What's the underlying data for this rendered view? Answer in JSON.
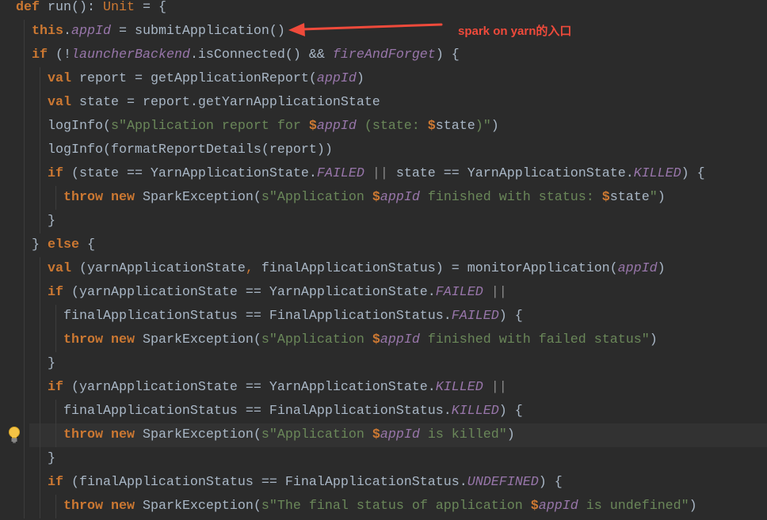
{
  "editor": {
    "language": "scala",
    "colors": {
      "background": "#2b2b2b",
      "caret_row": "#323232",
      "plain": "#a9b7c6",
      "keyword": "#cc7832",
      "field": "#9876aa",
      "string": "#6a8759",
      "operator": "#8a8a8a",
      "indent_guide": "#3c3c3c"
    },
    "lines": [
      {
        "indent": "",
        "tokens": [
          {
            "keyword": "def"
          },
          {
            "text": " run(): "
          },
          {
            "type": "Unit"
          },
          {
            "text": " = {"
          }
        ]
      },
      {
        "indent": "  ",
        "tokens": [
          {
            "keyword": "this"
          },
          {
            "text": "."
          },
          {
            "field": "appId"
          },
          {
            "text": " = submitApplication()"
          }
        ]
      },
      {
        "indent": "  ",
        "tokens": [
          {
            "keyword": "if"
          },
          {
            "text": " (!"
          },
          {
            "field": "launcherBackend"
          },
          {
            "text": ".isConnected() && "
          },
          {
            "field": "fireAndForget"
          },
          {
            "text": ") {"
          }
        ]
      },
      {
        "indent": "    ",
        "tokens": [
          {
            "keyword": "val"
          },
          {
            "text": " report = getApplicationReport("
          },
          {
            "field": "appId"
          },
          {
            "text": ")"
          }
        ]
      },
      {
        "indent": "    ",
        "tokens": [
          {
            "keyword": "val"
          },
          {
            "text": " state = report.getYarnApplicationState"
          }
        ]
      },
      {
        "indent": "    ",
        "tokens": [
          {
            "text": "logInfo("
          },
          {
            "string": "s\"Application report for "
          },
          {
            "interp": "$"
          },
          {
            "field": "appId"
          },
          {
            "string": " (state: "
          },
          {
            "interp": "$"
          },
          {
            "text": "state"
          },
          {
            "string": ")\""
          },
          {
            "text": ")"
          }
        ]
      },
      {
        "indent": "    ",
        "tokens": [
          {
            "text": "logInfo(formatReportDetails(report))"
          }
        ]
      },
      {
        "indent": "    ",
        "tokens": [
          {
            "keyword": "if"
          },
          {
            "text": " (state == YarnApplicationState."
          },
          {
            "field": "FAILED"
          },
          {
            "text": " "
          },
          {
            "op": "||"
          },
          {
            "text": " state == YarnApplicationState."
          },
          {
            "field": "KILLED"
          },
          {
            "text": ") {"
          }
        ]
      },
      {
        "indent": "      ",
        "tokens": [
          {
            "keyword": "throw"
          },
          {
            "text": " "
          },
          {
            "keyword": "new"
          },
          {
            "text": " SparkException("
          },
          {
            "string": "s\"Application "
          },
          {
            "interp": "$"
          },
          {
            "field": "appId"
          },
          {
            "string": " finished with status: "
          },
          {
            "interp": "$"
          },
          {
            "text": "state"
          },
          {
            "string": "\""
          },
          {
            "text": ")"
          }
        ]
      },
      {
        "indent": "    ",
        "tokens": [
          {
            "text": "}"
          }
        ]
      },
      {
        "indent": "  ",
        "tokens": [
          {
            "text": "} "
          },
          {
            "keyword": "else"
          },
          {
            "text": " {"
          }
        ]
      },
      {
        "indent": "    ",
        "tokens": [
          {
            "keyword": "val"
          },
          {
            "text": " (yarnApplicationState"
          },
          {
            "punct": ","
          },
          {
            "text": " finalApplicationStatus) = monitorApplication("
          },
          {
            "field": "appId"
          },
          {
            "text": ")"
          }
        ]
      },
      {
        "indent": "    ",
        "tokens": [
          {
            "keyword": "if"
          },
          {
            "text": " (yarnApplicationState == YarnApplicationState."
          },
          {
            "field": "FAILED"
          },
          {
            "text": " "
          },
          {
            "op": "||"
          }
        ]
      },
      {
        "indent": "      ",
        "tokens": [
          {
            "text": "finalApplicationStatus == FinalApplicationStatus."
          },
          {
            "field": "FAILED"
          },
          {
            "text": ") {"
          }
        ]
      },
      {
        "indent": "      ",
        "tokens": [
          {
            "keyword": "throw"
          },
          {
            "text": " "
          },
          {
            "keyword": "new"
          },
          {
            "text": " SparkException("
          },
          {
            "string": "s\"Application "
          },
          {
            "interp": "$"
          },
          {
            "field": "appId"
          },
          {
            "string": " finished with failed status\""
          },
          {
            "text": ")"
          }
        ]
      },
      {
        "indent": "    ",
        "tokens": [
          {
            "text": "}"
          }
        ]
      },
      {
        "indent": "    ",
        "tokens": [
          {
            "keyword": "if"
          },
          {
            "text": " (yarnApplicationState == YarnApplicationState."
          },
          {
            "field": "KILLED"
          },
          {
            "text": " "
          },
          {
            "op": "||"
          }
        ]
      },
      {
        "indent": "      ",
        "tokens": [
          {
            "text": "finalApplicationStatus == FinalApplicationStatus."
          },
          {
            "field": "KILLED"
          },
          {
            "text": ") {"
          }
        ]
      },
      {
        "indent": "      ",
        "caret": true,
        "intention_icon": "lightbulb-icon",
        "tokens": [
          {
            "keyword": "throw"
          },
          {
            "text": " "
          },
          {
            "keyword": "new"
          },
          {
            "text": " SparkException("
          },
          {
            "string": "s\"Application "
          },
          {
            "interp": "$"
          },
          {
            "field": "appId"
          },
          {
            "string": " is killed\""
          },
          {
            "text": ")"
          }
        ]
      },
      {
        "indent": "    ",
        "tokens": [
          {
            "text": "}"
          }
        ]
      },
      {
        "indent": "    ",
        "tokens": [
          {
            "keyword": "if"
          },
          {
            "text": " (finalApplicationStatus == FinalApplicationStatus."
          },
          {
            "field": "UNDEFINED"
          },
          {
            "text": ") {"
          }
        ]
      },
      {
        "indent": "      ",
        "tokens": [
          {
            "keyword": "throw"
          },
          {
            "text": " "
          },
          {
            "keyword": "new"
          },
          {
            "text": " SparkException("
          },
          {
            "string": "s\"The final status of application "
          },
          {
            "interp": "$"
          },
          {
            "field": "appId"
          },
          {
            "string": " is undefined\""
          },
          {
            "text": ")"
          }
        ]
      }
    ]
  },
  "annotation": {
    "text": "spark on yarn的入口",
    "color": "#ef4a3b",
    "icon": "arrow-left-icon"
  }
}
